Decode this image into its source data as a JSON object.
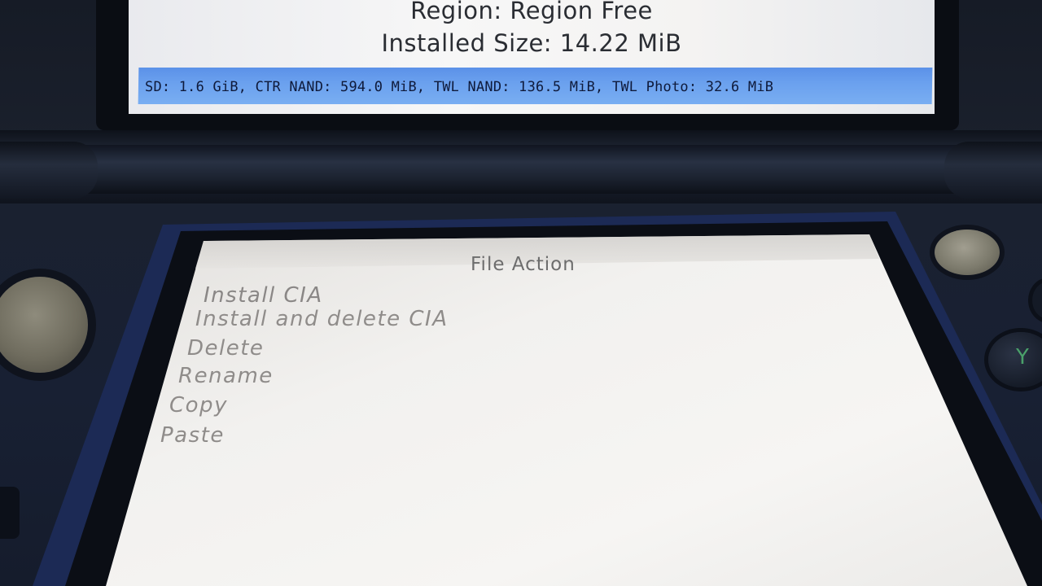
{
  "top_screen": {
    "region_line": "Region: Region Free",
    "installed_size_line": "Installed Size: 14.22 MiB",
    "storage_status": "SD: 1.6 GiB, CTR NAND: 594.0 MiB, TWL NAND: 136.5 MiB, TWL Photo: 32.6 MiB"
  },
  "bottom_screen": {
    "title": "File Action",
    "menu_items": [
      {
        "label": "Install CIA"
      },
      {
        "label": "Install and delete CIA"
      },
      {
        "label": "Delete"
      },
      {
        "label": "Rename"
      },
      {
        "label": "Copy"
      },
      {
        "label": "Paste"
      }
    ]
  },
  "buttons": {
    "y_button_glyph": "Y"
  },
  "colors": {
    "status_bar": "#6aa0ee",
    "console_body": "#1a2130",
    "touch_screen": "#f3f2f1"
  }
}
